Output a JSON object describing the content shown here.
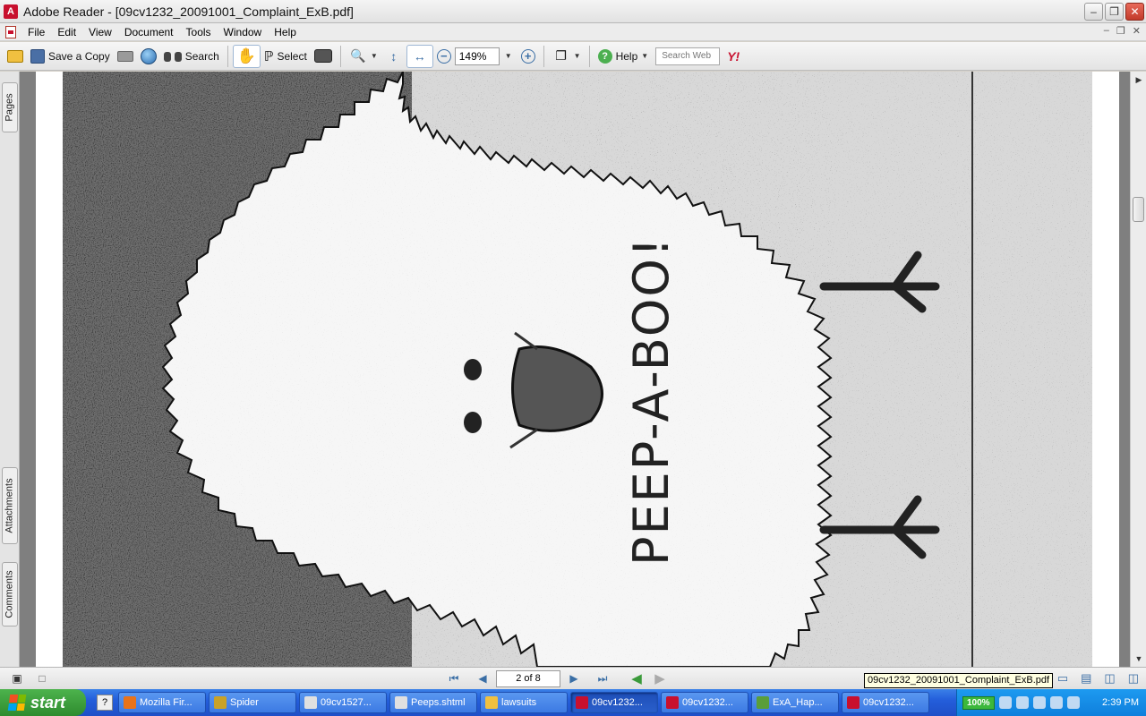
{
  "window": {
    "title": "Adobe Reader - [09cv1232_20091001_Complaint_ExB.pdf]",
    "app_icon_letter": "A"
  },
  "menu": [
    "File",
    "Edit",
    "View",
    "Document",
    "Tools",
    "Window",
    "Help"
  ],
  "toolbar": {
    "save_copy_label": "Save a Copy",
    "search_label": "Search",
    "select_label": "Select",
    "zoom_value": "149%",
    "help_label": "Help",
    "search_web_placeholder": "Search Web",
    "yahoo_label": "Y!"
  },
  "left_tabs": {
    "pages": "Pages",
    "attachments": "Attachments",
    "comments": "Comments"
  },
  "document": {
    "page_text": "PEEP-A-BOO!"
  },
  "nav": {
    "page_display": "2 of 8",
    "tooltip": "09cv1232_20091001_Complaint_ExB.pdf"
  },
  "taskbar": {
    "start_label": "start",
    "tasks": [
      {
        "label": "Mozilla Fir...",
        "icon_color": "#e8731a"
      },
      {
        "label": "Spider",
        "icon_color": "#c9a227"
      },
      {
        "label": "09cv1527...",
        "icon_color": "#e0e0e0"
      },
      {
        "label": "Peeps.shtml",
        "icon_color": "#e0e0e0"
      },
      {
        "label": "lawsuits",
        "icon_color": "#f0c040"
      },
      {
        "label": "09cv1232...",
        "icon_color": "#c8102e"
      },
      {
        "label": "09cv1232...",
        "icon_color": "#c8102e"
      },
      {
        "label": "ExA_Hap...",
        "icon_color": "#5a9e3a"
      },
      {
        "label": "09cv1232...",
        "icon_color": "#c8102e"
      }
    ],
    "active_task_index": 5,
    "tray_percent": "100%",
    "clock": "2:39 PM"
  }
}
